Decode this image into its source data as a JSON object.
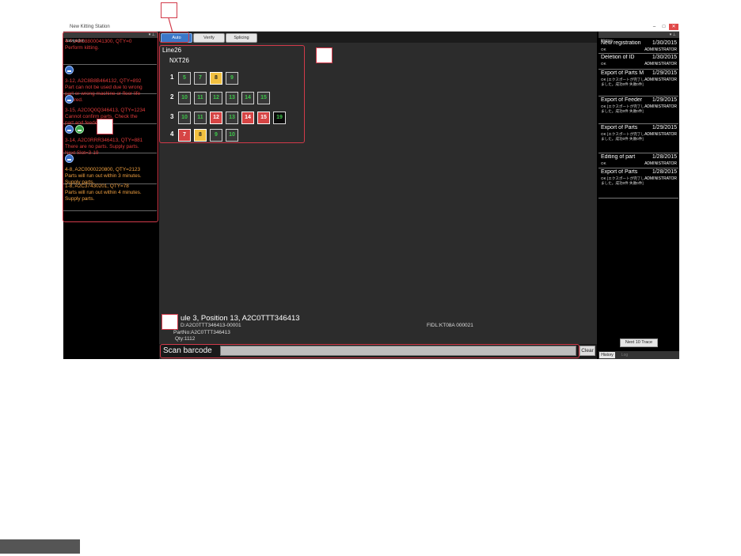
{
  "window": {
    "title": "New Kitting Station",
    "minimize": "–",
    "maximize": "□",
    "close": "✕"
  },
  "navigation": {
    "header": "Navigation",
    "items": [
      {
        "icons": [],
        "lines": [
          "4-7, A2C8800041300, QTY=0",
          "Perform kitting."
        ],
        "color": "red"
      },
      {
        "icons": [
          "blue"
        ],
        "lines": [
          "3-12, A2C8B8B464132, QTY=892",
          "Part can not be used due to  wrong",
          "part or wrong machine or floor life",
          "expired."
        ],
        "color": "red"
      },
      {
        "icons": [
          "blue"
        ],
        "lines": [
          "3-15, A2C0Q0Q346413, QTY=1234",
          "Cannot confirm parts. Check the",
          "part and feeder."
        ],
        "color": "red"
      },
      {
        "icons": [
          "blue",
          "green"
        ],
        "lines": [
          "3-14, A2C0RRR346413, QTY=881",
          "There are no parts. Supply parts.",
          "Next Slot=3-19"
        ],
        "color": "red"
      },
      {
        "icons": [
          "blue"
        ],
        "lines": [
          "4-8, A2C0000220800, QTY=2123",
          "Parts will run out within 3 minutes.",
          "Supply parts."
        ],
        "color": "orange"
      },
      {
        "icons": [],
        "lines": [
          "1-8, A2C37430201, QTY=78",
          "Parts will run out within 4 minutes.",
          "Supply parts."
        ],
        "color": "orange"
      }
    ]
  },
  "tabs": [
    {
      "label": "Auto",
      "active": true
    },
    {
      "label": "Verify",
      "active": false
    },
    {
      "label": "Splicing",
      "active": false
    }
  ],
  "line": "Line26",
  "machine": "NXT26",
  "modules": [
    {
      "num": "1",
      "slots": [
        {
          "n": "5",
          "s": "g"
        },
        {
          "n": "7",
          "s": "g"
        },
        {
          "n": "8",
          "s": "y"
        },
        {
          "n": "9",
          "s": "g"
        }
      ]
    },
    {
      "num": "2",
      "slots": [
        {
          "n": "10",
          "s": "g"
        },
        {
          "n": "11",
          "s": "g"
        },
        {
          "n": "12",
          "s": "g"
        },
        {
          "n": "13",
          "s": "g"
        },
        {
          "n": "14",
          "s": "g"
        },
        {
          "n": "15",
          "s": "g"
        }
      ]
    },
    {
      "num": "3",
      "slots": [
        {
          "n": "10",
          "s": "g"
        },
        {
          "n": "11",
          "s": "g"
        },
        {
          "n": "12",
          "s": "r"
        },
        {
          "n": "13",
          "s": "g"
        },
        {
          "n": "14",
          "s": "r"
        },
        {
          "n": "15",
          "s": "r"
        },
        {
          "n": "19",
          "s": "b"
        }
      ]
    },
    {
      "num": "4",
      "slots": [
        {
          "n": "7",
          "s": "r"
        },
        {
          "n": "8",
          "s": "y"
        },
        {
          "n": "9",
          "s": "g"
        },
        {
          "n": "10",
          "s": "g"
        }
      ]
    }
  ],
  "detail": {
    "title": "ule 3, Position 13, A2C0TTT346413",
    "id": "D:A2C0TTT346413-00001",
    "part": "PartNo:A2C0TTT346413",
    "qty": "Qty:1112",
    "fid": "FIDL:KT08A 000021"
  },
  "scan": {
    "label": "Scan barcode",
    "placeholder": "",
    "clear": "Clear"
  },
  "history": {
    "header": "History",
    "items": [
      {
        "title": "New registration",
        "date": "1/30/2015",
        "status": "OK",
        "user": "ADMINISTRATOR"
      },
      {
        "title": "Deletion of ID",
        "date": "1/30/2015",
        "status": "OK",
        "user": "ADMINISTRATOR"
      },
      {
        "title": "Export of Parts M",
        "date": "1/29/2015",
        "status": "OK [エクスポートが完了しました。成功0件 失敗0件]",
        "user": "ADMINISTRATOR"
      },
      {
        "title": "Export of Feeder",
        "date": "1/29/2015",
        "status": "OK [エクスポートが完了しました。成功0件 失敗0件]",
        "user": "ADMINISTRATOR"
      },
      {
        "title": "Export of Parts",
        "date": "1/29/2015",
        "status": "OK [エクスポートが完了しました。成功0件 失敗0件]",
        "user": "ADMINISTRATOR"
      },
      {
        "title": "Editing of part",
        "date": "1/28/2015",
        "status": "OK",
        "user": "ADMINISTRATOR"
      },
      {
        "title": "Export of Parts",
        "date": "1/28/2015",
        "status": "OK [エクスポートが完了しました。成功0件 失敗0件]",
        "user": "ADMINISTRATOR"
      }
    ],
    "next_button": "Next 10 Trace",
    "tab_active": "History",
    "tab_inactive": "Log"
  },
  "colors": {
    "callout": "#d23a4a",
    "active_tab": "#3b78c9",
    "slot_green": "#3ec74a",
    "slot_yellow": "#f2c040",
    "slot_red": "#d64545"
  }
}
